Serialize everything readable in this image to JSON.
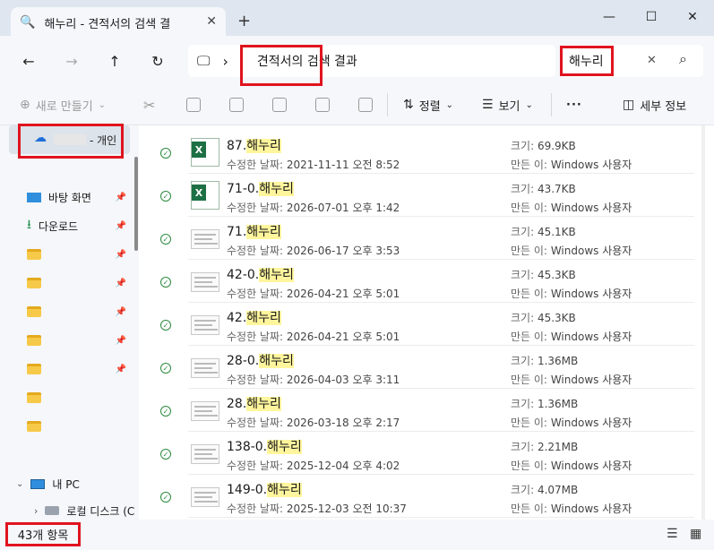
{
  "window": {
    "tab_title": "해누리 - 견적서의 검색 결",
    "tab_close": "✕",
    "new_tab": "+",
    "minimize": "—",
    "maximize": "☐",
    "close": "✕"
  },
  "nav": {
    "back": "←",
    "forward": "→",
    "up": "↑",
    "refresh": "↻"
  },
  "address": {
    "monitor_icon": "🖵",
    "chevron": "›",
    "path": "견적서의 검색 결과"
  },
  "search": {
    "query": "해누리",
    "clear": "✕",
    "search_icon": "⌕"
  },
  "commands": {
    "new": "새로 만들기",
    "sort": "정렬",
    "view": "보기",
    "more": "···",
    "details": "세부 정보"
  },
  "sidebar": {
    "account_suffix": "- 개인",
    "quick": [
      {
        "label": "바탕 화면",
        "type": "desktop"
      },
      {
        "label": "다운로드",
        "type": "download"
      },
      {
        "label": "",
        "type": "folder"
      },
      {
        "label": "",
        "type": "folder"
      },
      {
        "label": "",
        "type": "folder"
      },
      {
        "label": "",
        "type": "folder"
      },
      {
        "label": "",
        "type": "folder"
      },
      {
        "label": "",
        "type": "folder"
      },
      {
        "label": "",
        "type": "folder"
      }
    ],
    "pc": "내 PC",
    "local_disk": "로컬 디스크 (C"
  },
  "labels": {
    "modified": "수정한 날짜:",
    "size": "크기:",
    "author": "만든 이:"
  },
  "files": [
    {
      "prefix": "87.",
      "match": "해누리",
      "date": "2021-11-11 오전 8:52",
      "size": "69.9KB",
      "author": "Windows 사용자",
      "kind": "xl"
    },
    {
      "prefix": "71-0.",
      "match": "해누리",
      "date": "2026-07-01 오후 1:42",
      "size": "43.7KB",
      "author": "Windows 사용자",
      "kind": "xl"
    },
    {
      "prefix": "71.",
      "match": "해누리",
      "date": "2026-06-17 오후 3:53",
      "size": "45.1KB",
      "author": "Windows 사용자",
      "kind": "doc"
    },
    {
      "prefix": "42-0.",
      "match": "해누리",
      "date": "2026-04-21 오후 5:01",
      "size": "45.3KB",
      "author": "Windows 사용자",
      "kind": "doc"
    },
    {
      "prefix": "42.",
      "match": "해누리",
      "date": "2026-04-21 오후 5:01",
      "size": "45.3KB",
      "author": "Windows 사용자",
      "kind": "doc"
    },
    {
      "prefix": "28-0.",
      "match": "해누리",
      "date": "2026-04-03 오후 3:11",
      "size": "1.36MB",
      "author": "Windows 사용자",
      "kind": "doc"
    },
    {
      "prefix": "28.",
      "match": "해누리",
      "date": "2026-03-18 오후 2:17",
      "size": "1.36MB",
      "author": "Windows 사용자",
      "kind": "doc"
    },
    {
      "prefix": "138-0.",
      "match": "해누리",
      "date": "2025-12-04 오후 4:02",
      "size": "2.21MB",
      "author": "Windows 사용자",
      "kind": "doc"
    },
    {
      "prefix": "149-0.",
      "match": "해누리",
      "date": "2025-12-03 오전 10:37",
      "size": "4.07MB",
      "author": "Windows 사용자",
      "kind": "doc"
    }
  ],
  "status": {
    "count": "43개 항목"
  }
}
